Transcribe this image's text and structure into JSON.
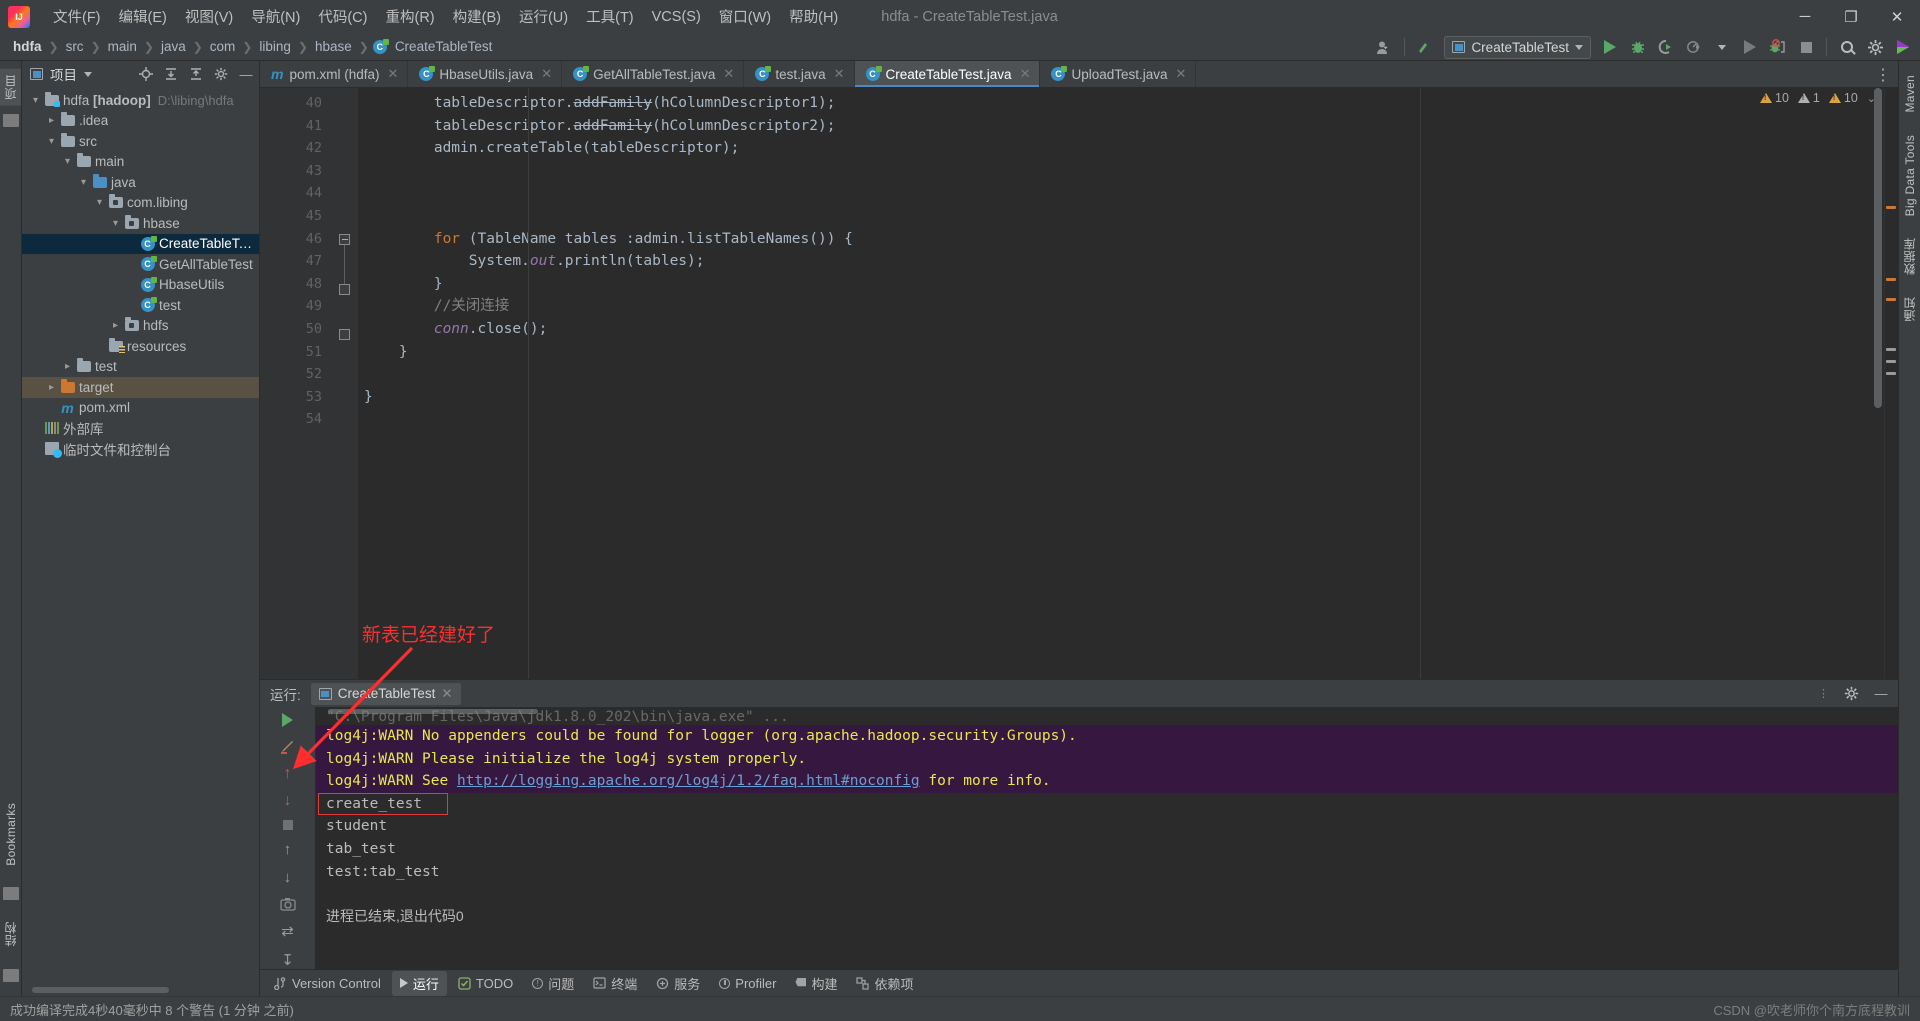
{
  "window": {
    "title": "hdfa - CreateTableTest.java",
    "controls": {
      "minimize": "─",
      "maximize": "❐",
      "close": "✕"
    }
  },
  "menubar": {
    "logo": "intellij-idea-logo",
    "items": [
      {
        "label": "文件(F)"
      },
      {
        "label": "编辑(E)"
      },
      {
        "label": "视图(V)"
      },
      {
        "label": "导航(N)"
      },
      {
        "label": "代码(C)"
      },
      {
        "label": "重构(R)"
      },
      {
        "label": "构建(B)"
      },
      {
        "label": "运行(U)"
      },
      {
        "label": "工具(T)"
      },
      {
        "label": "VCS(S)"
      },
      {
        "label": "窗口(W)"
      },
      {
        "label": "帮助(H)"
      }
    ]
  },
  "navbar": {
    "breadcrumbs": [
      {
        "label": "hdfa",
        "icon": ""
      },
      {
        "label": "src",
        "icon": ""
      },
      {
        "label": "main",
        "icon": ""
      },
      {
        "label": "java",
        "icon": ""
      },
      {
        "label": "com",
        "icon": ""
      },
      {
        "label": "libing",
        "icon": ""
      },
      {
        "label": "hbase",
        "icon": ""
      },
      {
        "label": "CreateTableTest",
        "icon": "class-icon"
      }
    ],
    "separator": "❯",
    "run_config": "CreateTableTest",
    "icons": {
      "user": "user-icon",
      "update": "update-project-icon",
      "run": "run-icon",
      "debug": "debug-icon",
      "coverage": "run-with-coverage-icon",
      "profiler": "profiler-icon",
      "run_dropdown": "run-anything-icon",
      "attach": "attach-debugger-icon",
      "stop": "stop-icon",
      "search": "search-icon",
      "settings": "settings-icon",
      "updates": "updates-icon"
    }
  },
  "left_rail": {
    "project_tab": "项目",
    "structure_tab": "结构",
    "bookmarks_tab": "Bookmarks",
    "favorites_tab": "收藏"
  },
  "right_rail": {
    "maven_tab": "Maven",
    "bigdata_tab": "Big Data Tools",
    "database_tab": "数据库",
    "notifications_tab": "通知"
  },
  "project_panel": {
    "title": "项目",
    "toolbar_icons": [
      "locate-icon",
      "expand-all-icon",
      "collapse-all-icon",
      "settings-icon",
      "hide-icon"
    ],
    "tree": [
      {
        "indent": 0,
        "arrow": "open",
        "icon": "module-folder",
        "label": "hdfa [hadoop]",
        "sub": "D:\\libing\\hdfa",
        "bold_part": "[hadoop]",
        "state": "normal"
      },
      {
        "indent": 1,
        "arrow": "closed",
        "icon": "folder",
        "label": ".idea",
        "sub": "",
        "state": "normal"
      },
      {
        "indent": 1,
        "arrow": "open",
        "icon": "folder",
        "label": "src",
        "sub": "",
        "state": "normal"
      },
      {
        "indent": 2,
        "arrow": "open",
        "icon": "folder",
        "label": "main",
        "sub": "",
        "state": "normal"
      },
      {
        "indent": 3,
        "arrow": "open",
        "icon": "source-folder",
        "label": "java",
        "sub": "",
        "state": "normal"
      },
      {
        "indent": 4,
        "arrow": "open",
        "icon": "package",
        "label": "com.libing",
        "sub": "",
        "state": "normal"
      },
      {
        "indent": 5,
        "arrow": "open",
        "icon": "package",
        "label": "hbase",
        "sub": "",
        "state": "normal"
      },
      {
        "indent": 6,
        "arrow": "none",
        "icon": "class",
        "label": "CreateTableTest",
        "sub": "",
        "state": "selected"
      },
      {
        "indent": 6,
        "arrow": "none",
        "icon": "class",
        "label": "GetAllTableTest",
        "sub": "",
        "state": "normal"
      },
      {
        "indent": 6,
        "arrow": "none",
        "icon": "class",
        "label": "HbaseUtils",
        "sub": "",
        "state": "normal"
      },
      {
        "indent": 6,
        "arrow": "none",
        "icon": "class",
        "label": "test",
        "sub": "",
        "state": "normal"
      },
      {
        "indent": 5,
        "arrow": "closed",
        "icon": "package",
        "label": "hdfs",
        "sub": "",
        "state": "normal"
      },
      {
        "indent": 4,
        "arrow": "none",
        "icon": "resource-folder",
        "label": "resources",
        "sub": "",
        "state": "normal"
      },
      {
        "indent": 2,
        "arrow": "closed",
        "icon": "folder",
        "label": "test",
        "sub": "",
        "state": "normal"
      },
      {
        "indent": 1,
        "arrow": "closed",
        "icon": "target-folder",
        "label": "target",
        "sub": "",
        "state": "highlighted"
      },
      {
        "indent": 1,
        "arrow": "none",
        "icon": "maven",
        "label": "pom.xml",
        "sub": "",
        "state": "normal"
      },
      {
        "indent": 0,
        "arrow": "none",
        "icon": "library",
        "label": "外部库",
        "sub": "",
        "state": "normal"
      },
      {
        "indent": 0,
        "arrow": "none",
        "icon": "scratch",
        "label": "临时文件和控制台",
        "sub": "",
        "state": "normal"
      }
    ]
  },
  "editor": {
    "tabs": [
      {
        "label": "pom.xml (hdfa)",
        "icon": "maven-icon",
        "active": false
      },
      {
        "label": "HbaseUtils.java",
        "icon": "class-icon",
        "active": false
      },
      {
        "label": "GetAllTableTest.java",
        "icon": "class-icon",
        "active": false
      },
      {
        "label": "test.java",
        "icon": "class-icon",
        "active": false
      },
      {
        "label": "CreateTableTest.java",
        "icon": "class-icon",
        "active": true
      },
      {
        "label": "UploadTest.java",
        "icon": "class-icon",
        "active": false
      }
    ],
    "close_glyph": "✕",
    "inspections": {
      "warnings": "10",
      "weak_warnings": "1",
      "typos": "10",
      "chevron": "⌄"
    },
    "first_line": 40,
    "lines": [
      {
        "n": 40,
        "tokens": [
          {
            "t": "        tableDescriptor.",
            "c": "plain"
          },
          {
            "t": "addFamily",
            "c": "dep"
          },
          {
            "t": "(hColumnDescriptor1);",
            "c": "plain"
          }
        ]
      },
      {
        "n": 41,
        "tokens": [
          {
            "t": "        tableDescriptor.",
            "c": "plain"
          },
          {
            "t": "addFamily",
            "c": "dep"
          },
          {
            "t": "(hColumnDescriptor2);",
            "c": "plain"
          }
        ]
      },
      {
        "n": 42,
        "tokens": [
          {
            "t": "        admin.createTable(tableDescriptor);",
            "c": "plain"
          }
        ]
      },
      {
        "n": 43,
        "tokens": []
      },
      {
        "n": 44,
        "tokens": []
      },
      {
        "n": 45,
        "tokens": []
      },
      {
        "n": 46,
        "tokens": [
          {
            "t": "        ",
            "c": "plain"
          },
          {
            "t": "for",
            "c": "kw"
          },
          {
            "t": " (TableName tables :admin.listTableNames()) {",
            "c": "plain"
          }
        ]
      },
      {
        "n": 47,
        "tokens": [
          {
            "t": "            System.",
            "c": "plain"
          },
          {
            "t": "out",
            "c": "fld"
          },
          {
            "t": ".println(tables);",
            "c": "plain"
          }
        ]
      },
      {
        "n": 48,
        "tokens": [
          {
            "t": "        }",
            "c": "plain"
          }
        ]
      },
      {
        "n": 49,
        "tokens": [
          {
            "t": "        //关闭连接",
            "c": "cmt"
          }
        ]
      },
      {
        "n": 50,
        "tokens": [
          {
            "t": "        ",
            "c": "plain"
          },
          {
            "t": "conn",
            "c": "fld"
          },
          {
            "t": ".close();",
            "c": "plain"
          }
        ]
      },
      {
        "n": 51,
        "tokens": [
          {
            "t": "    }",
            "c": "plain"
          }
        ]
      },
      {
        "n": 52,
        "tokens": []
      },
      {
        "n": 53,
        "tokens": [
          {
            "t": "}",
            "c": "plain"
          }
        ]
      },
      {
        "n": 54,
        "tokens": []
      }
    ]
  },
  "annotation": {
    "text": "新表已经建好了",
    "color": "#ff2d2d",
    "arrow": "red-arrow"
  },
  "run_panel": {
    "label": "运行:",
    "tab_name": "CreateTableTest",
    "close_glyph": "✕",
    "gutter_icons": [
      "rerun-icon",
      "edit-config-icon",
      "scroll-up-icon",
      "scroll-down-icon",
      "stop-icon",
      "up-icon",
      "down-icon",
      "camera-icon",
      "soft-wrap-icon",
      "scroll-to-end-icon",
      "print-icon"
    ],
    "header_icons": [
      "settings-icon",
      "hide-icon"
    ],
    "command_line": "\"C:\\Program Files\\Java\\jdk1.8.0_202\\bin\\java.exe\" ...",
    "output": [
      {
        "type": "warn",
        "text": "log4j:WARN No appenders could be found for logger (org.apache.hadoop.security.Groups)."
      },
      {
        "type": "warn",
        "text": "log4j:WARN Please initialize the log4j system properly."
      },
      {
        "type": "warn-link",
        "prefix": "log4j:WARN See ",
        "link": "http://logging.apache.org/log4j/1.2/faq.html#noconfig",
        "suffix": " for more info."
      },
      {
        "type": "out",
        "text": "create_test",
        "boxed": true
      },
      {
        "type": "out",
        "text": "student"
      },
      {
        "type": "out",
        "text": "tab_test"
      },
      {
        "type": "out",
        "text": "test:tab_test"
      },
      {
        "type": "exit",
        "text": "进程已结束,退出代码0"
      }
    ]
  },
  "bottom_bar": {
    "items": [
      {
        "label": "Version Control",
        "icon": "version-control-icon",
        "active": false
      },
      {
        "label": "运行",
        "icon": "run-icon",
        "active": true
      },
      {
        "label": "TODO",
        "icon": "todo-icon",
        "active": false
      },
      {
        "label": "问题",
        "icon": "problems-icon",
        "active": false
      },
      {
        "label": "终端",
        "icon": "terminal-icon",
        "active": false
      },
      {
        "label": "服务",
        "icon": "services-icon",
        "active": false
      },
      {
        "label": "Profiler",
        "icon": "profiler-icon",
        "active": false
      },
      {
        "label": "构建",
        "icon": "build-icon",
        "active": false
      },
      {
        "label": "依赖项",
        "icon": "dependencies-icon",
        "active": false
      }
    ]
  },
  "status_bar": {
    "message": "成功编译完成4秒40毫秒中 8 个警告 (1 分钟 之前)",
    "watermark": "CSDN @吹老师你个南方底程教训"
  }
}
